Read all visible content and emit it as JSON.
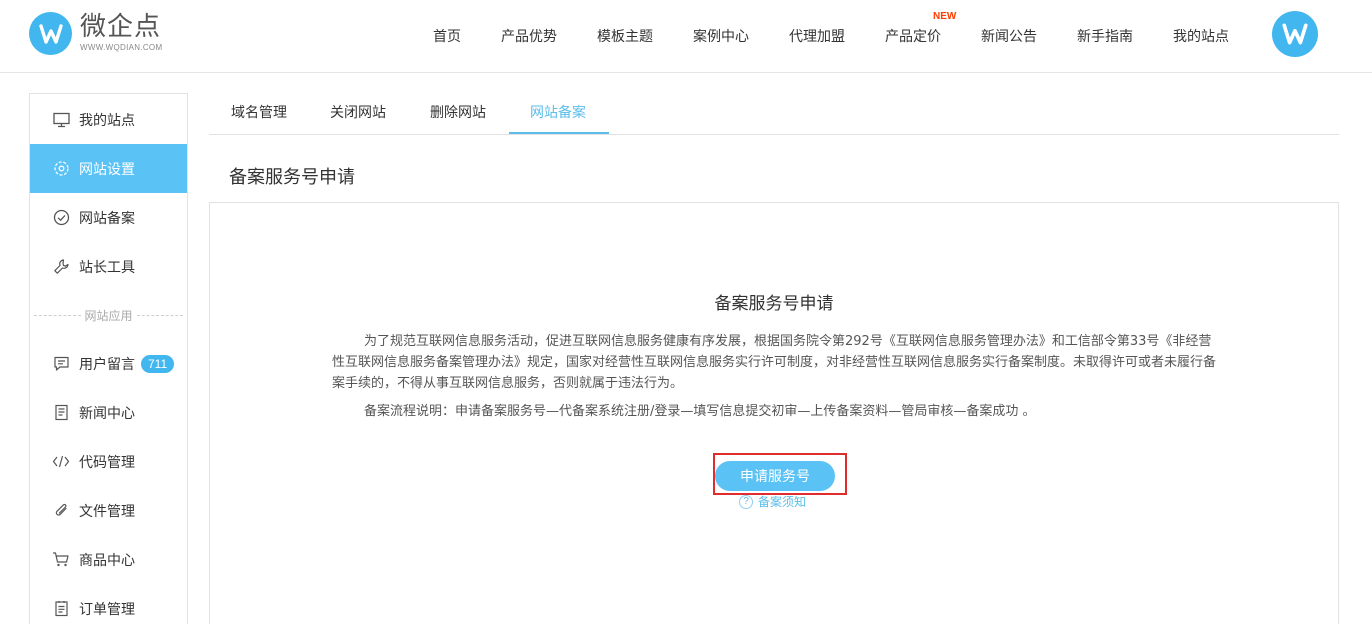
{
  "brand": {
    "name": "微企点",
    "url_text": "WWW.WQDIAN.COM",
    "color": "#41b6ef"
  },
  "nav": {
    "items": [
      "首页",
      "产品优势",
      "模板主题",
      "案例中心",
      "代理加盟",
      "产品定价",
      "新闻公告",
      "新手指南",
      "我的站点"
    ],
    "new_badge": "NEW"
  },
  "sidebar": {
    "items": [
      {
        "label": "我的站点",
        "icon": "monitor-icon"
      },
      {
        "label": "网站设置",
        "icon": "gear-icon",
        "active": true
      },
      {
        "label": "网站备案",
        "icon": "check-circle-icon"
      },
      {
        "label": "站长工具",
        "icon": "wrench-icon"
      },
      {
        "label": "用户留言",
        "icon": "message-icon",
        "badge": "711"
      },
      {
        "label": "新闻中心",
        "icon": "document-icon"
      },
      {
        "label": "代码管理",
        "icon": "code-icon"
      },
      {
        "label": "文件管理",
        "icon": "paperclip-icon"
      },
      {
        "label": "商品中心",
        "icon": "cart-icon"
      },
      {
        "label": "订单管理",
        "icon": "list-icon"
      }
    ],
    "section_label": "网站应用",
    "active_color": "#5bc2f6"
  },
  "tabs": {
    "items": [
      "域名管理",
      "关闭网站",
      "删除网站",
      "网站备案"
    ],
    "active": "网站备案"
  },
  "page_title": "备案服务号申请",
  "panel": {
    "heading": "备案服务号申请",
    "paragraph1": "为了规范互联网信息服务活动，促进互联网信息服务健康有序发展，根据国务院令第292号《互联网信息服务管理办法》和工信部令第33号《非经营性互联网信息服务备案管理办法》规定，国家对经营性互联网信息服务实行许可制度，对非经营性互联网信息服务实行备案制度。未取得许可或者未履行备案手续的，不得从事互联网信息服务，否则就属于违法行为。",
    "paragraph2": "备案流程说明：申请备案服务号—代备案系统注册/登录—填写信息提交初审—上传备案资料—管局审核—备案成功 。",
    "apply_button": "申请服务号",
    "help_link": "备案须知",
    "help_icon_glyph": "?"
  }
}
